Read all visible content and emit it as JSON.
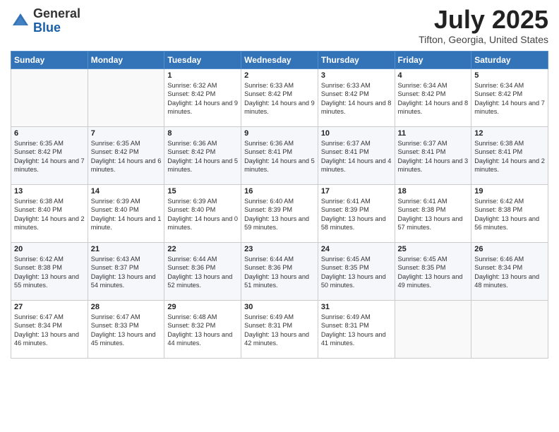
{
  "logo": {
    "general": "General",
    "blue": "Blue"
  },
  "header": {
    "month": "July 2025",
    "location": "Tifton, Georgia, United States"
  },
  "weekdays": [
    "Sunday",
    "Monday",
    "Tuesday",
    "Wednesday",
    "Thursday",
    "Friday",
    "Saturday"
  ],
  "weeks": [
    [
      {
        "day": "",
        "info": ""
      },
      {
        "day": "",
        "info": ""
      },
      {
        "day": "1",
        "info": "Sunrise: 6:32 AM\nSunset: 8:42 PM\nDaylight: 14 hours and 9 minutes."
      },
      {
        "day": "2",
        "info": "Sunrise: 6:33 AM\nSunset: 8:42 PM\nDaylight: 14 hours and 9 minutes."
      },
      {
        "day": "3",
        "info": "Sunrise: 6:33 AM\nSunset: 8:42 PM\nDaylight: 14 hours and 8 minutes."
      },
      {
        "day": "4",
        "info": "Sunrise: 6:34 AM\nSunset: 8:42 PM\nDaylight: 14 hours and 8 minutes."
      },
      {
        "day": "5",
        "info": "Sunrise: 6:34 AM\nSunset: 8:42 PM\nDaylight: 14 hours and 7 minutes."
      }
    ],
    [
      {
        "day": "6",
        "info": "Sunrise: 6:35 AM\nSunset: 8:42 PM\nDaylight: 14 hours and 7 minutes."
      },
      {
        "day": "7",
        "info": "Sunrise: 6:35 AM\nSunset: 8:42 PM\nDaylight: 14 hours and 6 minutes."
      },
      {
        "day": "8",
        "info": "Sunrise: 6:36 AM\nSunset: 8:42 PM\nDaylight: 14 hours and 5 minutes."
      },
      {
        "day": "9",
        "info": "Sunrise: 6:36 AM\nSunset: 8:41 PM\nDaylight: 14 hours and 5 minutes."
      },
      {
        "day": "10",
        "info": "Sunrise: 6:37 AM\nSunset: 8:41 PM\nDaylight: 14 hours and 4 minutes."
      },
      {
        "day": "11",
        "info": "Sunrise: 6:37 AM\nSunset: 8:41 PM\nDaylight: 14 hours and 3 minutes."
      },
      {
        "day": "12",
        "info": "Sunrise: 6:38 AM\nSunset: 8:41 PM\nDaylight: 14 hours and 2 minutes."
      }
    ],
    [
      {
        "day": "13",
        "info": "Sunrise: 6:38 AM\nSunset: 8:40 PM\nDaylight: 14 hours and 2 minutes."
      },
      {
        "day": "14",
        "info": "Sunrise: 6:39 AM\nSunset: 8:40 PM\nDaylight: 14 hours and 1 minute."
      },
      {
        "day": "15",
        "info": "Sunrise: 6:39 AM\nSunset: 8:40 PM\nDaylight: 14 hours and 0 minutes."
      },
      {
        "day": "16",
        "info": "Sunrise: 6:40 AM\nSunset: 8:39 PM\nDaylight: 13 hours and 59 minutes."
      },
      {
        "day": "17",
        "info": "Sunrise: 6:41 AM\nSunset: 8:39 PM\nDaylight: 13 hours and 58 minutes."
      },
      {
        "day": "18",
        "info": "Sunrise: 6:41 AM\nSunset: 8:38 PM\nDaylight: 13 hours and 57 minutes."
      },
      {
        "day": "19",
        "info": "Sunrise: 6:42 AM\nSunset: 8:38 PM\nDaylight: 13 hours and 56 minutes."
      }
    ],
    [
      {
        "day": "20",
        "info": "Sunrise: 6:42 AM\nSunset: 8:38 PM\nDaylight: 13 hours and 55 minutes."
      },
      {
        "day": "21",
        "info": "Sunrise: 6:43 AM\nSunset: 8:37 PM\nDaylight: 13 hours and 54 minutes."
      },
      {
        "day": "22",
        "info": "Sunrise: 6:44 AM\nSunset: 8:36 PM\nDaylight: 13 hours and 52 minutes."
      },
      {
        "day": "23",
        "info": "Sunrise: 6:44 AM\nSunset: 8:36 PM\nDaylight: 13 hours and 51 minutes."
      },
      {
        "day": "24",
        "info": "Sunrise: 6:45 AM\nSunset: 8:35 PM\nDaylight: 13 hours and 50 minutes."
      },
      {
        "day": "25",
        "info": "Sunrise: 6:45 AM\nSunset: 8:35 PM\nDaylight: 13 hours and 49 minutes."
      },
      {
        "day": "26",
        "info": "Sunrise: 6:46 AM\nSunset: 8:34 PM\nDaylight: 13 hours and 48 minutes."
      }
    ],
    [
      {
        "day": "27",
        "info": "Sunrise: 6:47 AM\nSunset: 8:34 PM\nDaylight: 13 hours and 46 minutes."
      },
      {
        "day": "28",
        "info": "Sunrise: 6:47 AM\nSunset: 8:33 PM\nDaylight: 13 hours and 45 minutes."
      },
      {
        "day": "29",
        "info": "Sunrise: 6:48 AM\nSunset: 8:32 PM\nDaylight: 13 hours and 44 minutes."
      },
      {
        "day": "30",
        "info": "Sunrise: 6:49 AM\nSunset: 8:31 PM\nDaylight: 13 hours and 42 minutes."
      },
      {
        "day": "31",
        "info": "Sunrise: 6:49 AM\nSunset: 8:31 PM\nDaylight: 13 hours and 41 minutes."
      },
      {
        "day": "",
        "info": ""
      },
      {
        "day": "",
        "info": ""
      }
    ]
  ]
}
